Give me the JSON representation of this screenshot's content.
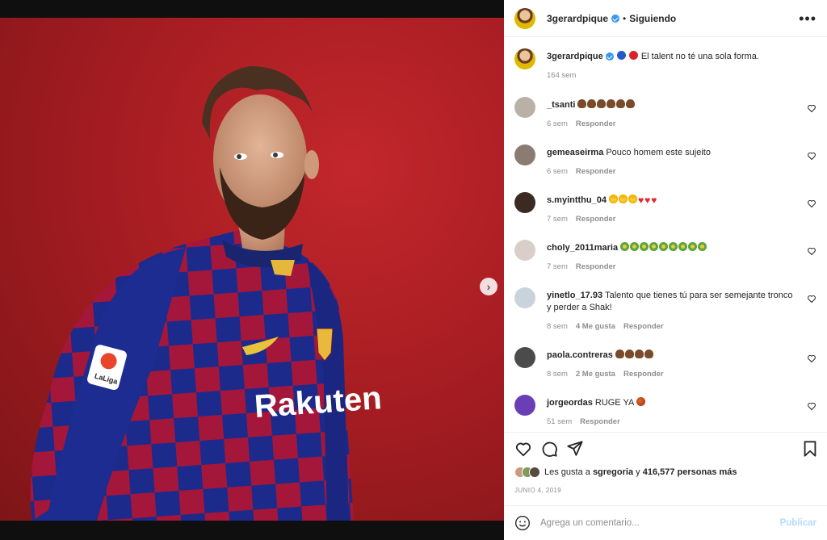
{
  "post": {
    "owner_username": "3gerardpique",
    "follow_separator": "•",
    "follow_status": "Siguiendo",
    "more_icon": "•••",
    "next_arrow": "›",
    "jersey_sponsor": "Rakuten",
    "sleeve_patch": "LaLiga"
  },
  "caption": {
    "username": "3gerardpique",
    "text": "El talent no té una sola forma.",
    "time": "164 sem",
    "emojis": [
      "blue-circle",
      "red-circle"
    ]
  },
  "comments": [
    {
      "username": "_tsanti",
      "text": "",
      "emojis": [
        "poop",
        "poop",
        "poop",
        "poop",
        "poop",
        "poop"
      ],
      "time": "6 sem",
      "likes": "",
      "reply": "Responder",
      "avatar_color": "#b9b1a8"
    },
    {
      "username": "gemeaseirma",
      "text": "Pouco homem este sujeito",
      "emojis": [],
      "time": "6 sem",
      "likes": "",
      "reply": "Responder",
      "avatar_color": "#8a7c73"
    },
    {
      "username": "s.myintthu_04",
      "text": "",
      "emojis": [
        "starstruck",
        "starstruck",
        "starstruck",
        "heart",
        "heart",
        "heart"
      ],
      "time": "7 sem",
      "likes": "",
      "reply": "Responder",
      "avatar_color": "#3a2a22"
    },
    {
      "username": "choly_2011maria",
      "text": "",
      "emojis": [
        "cry",
        "cry",
        "cry",
        "cry",
        "cry",
        "cry",
        "cry",
        "cry",
        "cry"
      ],
      "time": "7 sem",
      "likes": "",
      "reply": "Responder",
      "avatar_color": "#d9cfc8"
    },
    {
      "username": "yinetlo_17.93",
      "text": "Talento que tienes tú para ser semejante tronco y perder a Shak!",
      "emojis": [],
      "time": "8 sem",
      "likes": "4 Me gusta",
      "reply": "Responder",
      "avatar_color": "#c9d3dc"
    },
    {
      "username": "paola.contreras",
      "text": "",
      "emojis": [
        "poop",
        "poop",
        "poop",
        "poop"
      ],
      "time": "8 sem",
      "likes": "2 Me gusta",
      "reply": "Responder",
      "avatar_color": "#4b4b4b"
    },
    {
      "username": "jorgeordas",
      "text": "RUGE YA",
      "emojis": [
        "basketball"
      ],
      "time": "51 sem",
      "likes": "",
      "reply": "Responder",
      "avatar_color": "#6a3fb5"
    }
  ],
  "actions": {
    "like_icon": "heart-icon",
    "comment_icon": "comment-icon",
    "share_icon": "share-icon",
    "save_icon": "bookmark-icon"
  },
  "likes": {
    "prefix": "Les gusta a",
    "user": "sgregoria",
    "middle": "y",
    "count": "416,577 personas más"
  },
  "date": "JUNIO 4, 2019",
  "add_comment": {
    "placeholder": "Agrega un comentario...",
    "post_label": "Publicar"
  },
  "carousel": {
    "count": 2,
    "active": 0
  },
  "colors": {
    "accent": "#3897f0",
    "photo_bg": "#a71d22",
    "muted": "#8e8e8e"
  }
}
